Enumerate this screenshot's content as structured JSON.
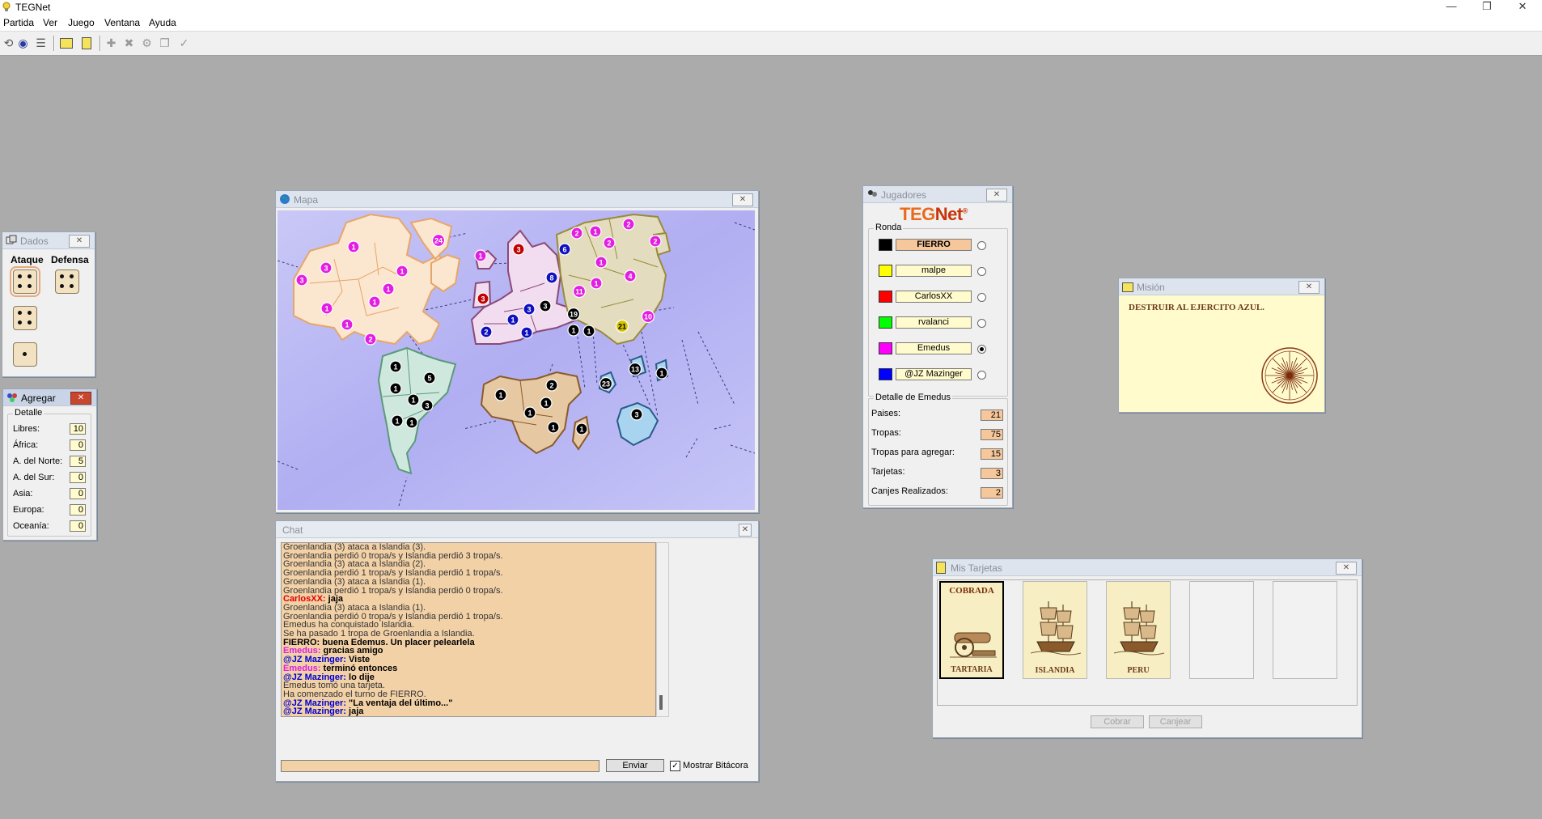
{
  "app": {
    "title": "TEGNet"
  },
  "window_buttons": {
    "minimize": "—",
    "restore": "❐",
    "close": "✕"
  },
  "menu": [
    "Partida",
    "Ver",
    "Juego",
    "Ventana",
    "Ayuda"
  ],
  "toolbar": {
    "icons": [
      "connect-icon",
      "globe-icon",
      "list-icon",
      "map-card-icon",
      "mission-icon",
      "add-icon",
      "remove-icon",
      "gear-icon",
      "copy-icon",
      "check-icon"
    ]
  },
  "dados": {
    "title": "Dados",
    "attack_label": "Ataque",
    "defense_label": "Defensa",
    "attack_dice": [
      4,
      4,
      1
    ],
    "defense_dice": [
      4
    ]
  },
  "agregar": {
    "title": "Agregar",
    "group_label": "Detalle",
    "rows": [
      {
        "label": "Libres:",
        "value": "10"
      },
      {
        "label": "África:",
        "value": "0"
      },
      {
        "label": "A. del Norte:",
        "value": "5"
      },
      {
        "label": "A. del Sur:",
        "value": "0"
      },
      {
        "label": "Asia:",
        "value": "0"
      },
      {
        "label": "Europa:",
        "value": "0"
      },
      {
        "label": "Oceanía:",
        "value": "0"
      }
    ]
  },
  "mapa": {
    "title": "Mapa",
    "colors": {
      "sea": "#b7b5f0",
      "north_america": "#fbe6cf",
      "south_america": "#cfe8dd",
      "europe": "#f2dcef",
      "asia": "#e3dcbf",
      "africa": "#e6c9a2",
      "oceania": "#a9d4f0"
    },
    "armies": [
      {
        "n": "24",
        "c": "#e31ee3"
      },
      {
        "n": "1",
        "c": "#e31ee3"
      },
      {
        "n": "3",
        "c": "#e31ee3"
      },
      {
        "n": "3",
        "c": "#e31ee3"
      },
      {
        "n": "1",
        "c": "#e31ee3"
      },
      {
        "n": "1",
        "c": "#e31ee3"
      },
      {
        "n": "1",
        "c": "#e31ee3"
      },
      {
        "n": "1",
        "c": "#e31ee3"
      },
      {
        "n": "1",
        "c": "#e31ee3"
      },
      {
        "n": "2",
        "c": "#e31ee3"
      },
      {
        "n": "1",
        "c": "#e31ee3"
      },
      {
        "n": "3",
        "c": "#c20000"
      },
      {
        "n": "3",
        "c": "#c20000"
      },
      {
        "n": "6",
        "c": "#1010c0"
      },
      {
        "n": "8",
        "c": "#1010c0"
      },
      {
        "n": "3",
        "c": "#1010c0"
      },
      {
        "n": "1",
        "c": "#1010c0"
      },
      {
        "n": "2",
        "c": "#1010c0"
      },
      {
        "n": "1",
        "c": "#1010c0"
      },
      {
        "n": "3",
        "c": "#000000"
      },
      {
        "n": "19",
        "c": "#000000"
      },
      {
        "n": "1",
        "c": "#000000"
      },
      {
        "n": "1",
        "c": "#000000"
      },
      {
        "n": "21",
        "c": "#d4c400"
      },
      {
        "n": "2",
        "c": "#e31ee3"
      },
      {
        "n": "1",
        "c": "#e31ee3"
      },
      {
        "n": "2",
        "c": "#e31ee3"
      },
      {
        "n": "2",
        "c": "#e31ee3"
      },
      {
        "n": "2",
        "c": "#e31ee3"
      },
      {
        "n": "1",
        "c": "#e31ee3"
      },
      {
        "n": "4",
        "c": "#e31ee3"
      },
      {
        "n": "1",
        "c": "#e31ee3"
      },
      {
        "n": "11",
        "c": "#e31ee3"
      },
      {
        "n": "10",
        "c": "#e31ee3"
      },
      {
        "n": "1",
        "c": "#000000"
      },
      {
        "n": "5",
        "c": "#000000"
      },
      {
        "n": "1",
        "c": "#000000"
      },
      {
        "n": "1",
        "c": "#000000"
      },
      {
        "n": "3",
        "c": "#000000"
      },
      {
        "n": "1",
        "c": "#000000"
      },
      {
        "n": "1",
        "c": "#000000"
      },
      {
        "n": "1",
        "c": "#000000"
      },
      {
        "n": "2",
        "c": "#000000"
      },
      {
        "n": "1",
        "c": "#000000"
      },
      {
        "n": "1",
        "c": "#000000"
      },
      {
        "n": "1",
        "c": "#000000"
      },
      {
        "n": "1",
        "c": "#000000"
      },
      {
        "n": "23",
        "c": "#000000"
      },
      {
        "n": "13",
        "c": "#000000"
      },
      {
        "n": "1",
        "c": "#000000"
      },
      {
        "n": "3",
        "c": "#000000"
      }
    ]
  },
  "chat": {
    "title": "Chat",
    "lines": [
      {
        "text": "Groenlandia (3) ataca a Islandia (3).",
        "speaker": "",
        "color": ""
      },
      {
        "text": "Groenlandia perdió 0 tropa/s y Islandia perdió 3 tropa/s.",
        "speaker": "",
        "color": ""
      },
      {
        "text": "Groenlandia (3) ataca a Islandia (2).",
        "speaker": "",
        "color": ""
      },
      {
        "text": "Groenlandia perdió 1 tropa/s y Islandia perdió 1 tropa/s.",
        "speaker": "",
        "color": ""
      },
      {
        "text": "Groenlandia (3) ataca a Islandia (1).",
        "speaker": "",
        "color": ""
      },
      {
        "text": "Groenlandia perdió 1 tropa/s y Islandia perdió 0 tropa/s.",
        "speaker": "",
        "color": ""
      },
      {
        "text": "jaja",
        "speaker": "CarlosXX:",
        "color": "#e00000"
      },
      {
        "text": "Groenlandia (3) ataca a Islandia (1).",
        "speaker": "",
        "color": ""
      },
      {
        "text": "Groenlandia perdió 0 tropa/s y Islandia perdió 1 tropa/s.",
        "speaker": "",
        "color": ""
      },
      {
        "text": "Emedus ha conquistado Islandia.",
        "speaker": "",
        "color": ""
      },
      {
        "text": "Se ha pasado 1 tropa de Groenlandia a Islandia.",
        "speaker": "",
        "color": ""
      },
      {
        "text": "buena Edemus. Un placer pelearlela",
        "speaker": "FIERRO:",
        "color": "#000000"
      },
      {
        "text": "gracias amigo",
        "speaker": "Emedus:",
        "color": "#e01ee0"
      },
      {
        "text": "Viste",
        "speaker": "@JZ Mazinger:",
        "color": "#0000d0"
      },
      {
        "text": "terminó entonces",
        "speaker": "Emedus:",
        "color": "#e01ee0"
      },
      {
        "text": "lo dije",
        "speaker": "@JZ Mazinger:",
        "color": "#0000d0"
      },
      {
        "text": "Emedus tomó una tarjeta.",
        "speaker": "",
        "color": ""
      },
      {
        "text": "Ha comenzado el turno de FIERRO.",
        "speaker": "",
        "color": ""
      },
      {
        "text": "\"La ventaja del último...\"",
        "speaker": "@JZ Mazinger:",
        "color": "#0000d0"
      },
      {
        "text": "jaja",
        "speaker": "@JZ Mazinger:",
        "color": "#0000d0"
      }
    ],
    "input_value": "",
    "send_label": "Enviar",
    "log_checkbox_label": "Mostrar Bitácora",
    "log_checked": true
  },
  "jugadores": {
    "title": "Jugadores",
    "logo_a": "TEG",
    "logo_b": "Net",
    "logo_reg": "®",
    "group_label": "Ronda",
    "players": [
      {
        "name": "FIERRO",
        "color": "#000000",
        "turn": true,
        "selected": false
      },
      {
        "name": "malpe",
        "color": "#ffff00",
        "turn": false,
        "selected": false
      },
      {
        "name": "CarlosXX",
        "color": "#ff0000",
        "turn": false,
        "selected": false
      },
      {
        "name": "rvalanci",
        "color": "#00ff00",
        "turn": false,
        "selected": false
      },
      {
        "name": "Emedus",
        "color": "#ff00ff",
        "turn": false,
        "selected": true
      },
      {
        "name": "@JZ Mazinger",
        "color": "#0000ff",
        "turn": false,
        "selected": false
      }
    ],
    "detail_label": "Detalle de Emedus",
    "detail": [
      {
        "label": "Paises:",
        "value": "21"
      },
      {
        "label": "Tropas:",
        "value": "75"
      },
      {
        "label": "Tropas para agregar:",
        "value": "15"
      },
      {
        "label": "Tarjetas:",
        "value": "3"
      },
      {
        "label": "Canjes Realizados:",
        "value": "2"
      }
    ]
  },
  "mision": {
    "title": "Misión",
    "text": "DESTRUIR AL EJERCITO AZUL."
  },
  "tarjetas": {
    "title": "Mis Tarjetas",
    "cards": [
      {
        "name": "TARTARIA",
        "kind": "cannon",
        "status": "COBRADA"
      },
      {
        "name": "ISLANDIA",
        "kind": "ship",
        "status": ""
      },
      {
        "name": "PERU",
        "kind": "ship",
        "status": ""
      },
      {
        "name": "",
        "kind": "empty",
        "status": ""
      },
      {
        "name": "",
        "kind": "empty",
        "status": ""
      }
    ],
    "cobrar_label": "Cobrar",
    "canjear_label": "Canjear"
  }
}
